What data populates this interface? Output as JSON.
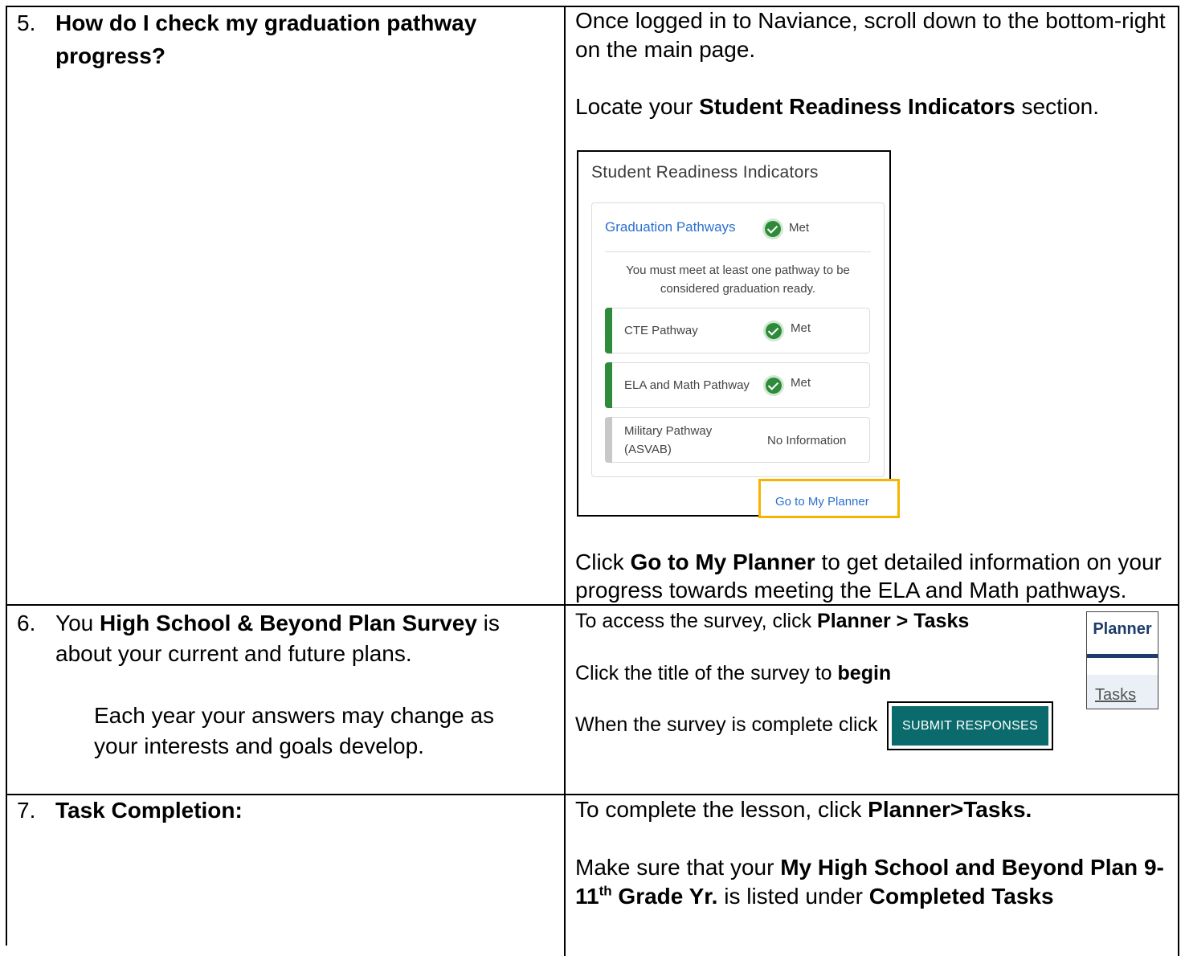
{
  "row5": {
    "number": "5.",
    "question_line1": "How do I check my graduation pathway",
    "question_line2": "progress?",
    "answer_line1": "Once logged in to Naviance, scroll down to the bottom-right",
    "answer_line2": "on the main page.",
    "locate_prefix": "Locate your ",
    "locate_bold": "Student Readiness Indicators",
    "locate_suffix": " section.",
    "click_prefix": "Click ",
    "click_bold": "Go to My Planner",
    "click_suffix": " to get detailed information on your",
    "click_line2": "progress towards meeting the ELA and Math pathways."
  },
  "sri": {
    "title": "Student Readiness Indicators",
    "graduation_pathways": "Graduation Pathways",
    "gp_status": "Met",
    "note": "You must meet at least one pathway to be considered graduation ready.",
    "pathways": [
      {
        "name": "CTE Pathway",
        "status": "Met",
        "color": "#2e8b3a"
      },
      {
        "name": "ELA and Math Pathway",
        "status": "Met",
        "color": "#2e8b3a"
      },
      {
        "name_line1": "Military Pathway",
        "name_line2": "(ASVAB)",
        "status": "No Information",
        "color": "#c8c8c8"
      }
    ],
    "goto_label": "Go to My Planner"
  },
  "row6": {
    "number": "6.",
    "q_prefix": "You ",
    "q_bold": "High School & Beyond Plan Survey",
    "q_suffix": " is",
    "q_line2": "about your current and future plans.",
    "q_line3": "Each year your answers may change as",
    "q_line4": "your interests and goals develop.",
    "access_prefix": "To access the survey, click ",
    "access_bold": "Planner > Tasks",
    "title_prefix": "Click the title of the survey to ",
    "title_bold": "begin",
    "complete_text": "When the survey is complete click",
    "submit_label": "SUBMIT RESPONSES",
    "planner_label": "Planner",
    "tasks_label": "Tasks"
  },
  "row7": {
    "number": "7.",
    "title": "Task Completion:",
    "line1_prefix": "To complete the lesson, click ",
    "line1_bold": "Planner>Tasks.",
    "line2_prefix": "Make sure that your ",
    "line2_bold": "My High School and Beyond Plan 9-",
    "line3_bold_a": "11",
    "line3_sup": "th",
    "line3_bold_b": " Grade Yr.",
    "line3_mid": " is listed under ",
    "line3_bold_c": "Completed Tasks"
  },
  "colors": {
    "link_blue": "#2a6fd0",
    "met_green": "#2e8b3a",
    "highlight": "#f5b400",
    "submit_teal": "#0b6a6b",
    "planner_navy": "#1f3c6b"
  }
}
